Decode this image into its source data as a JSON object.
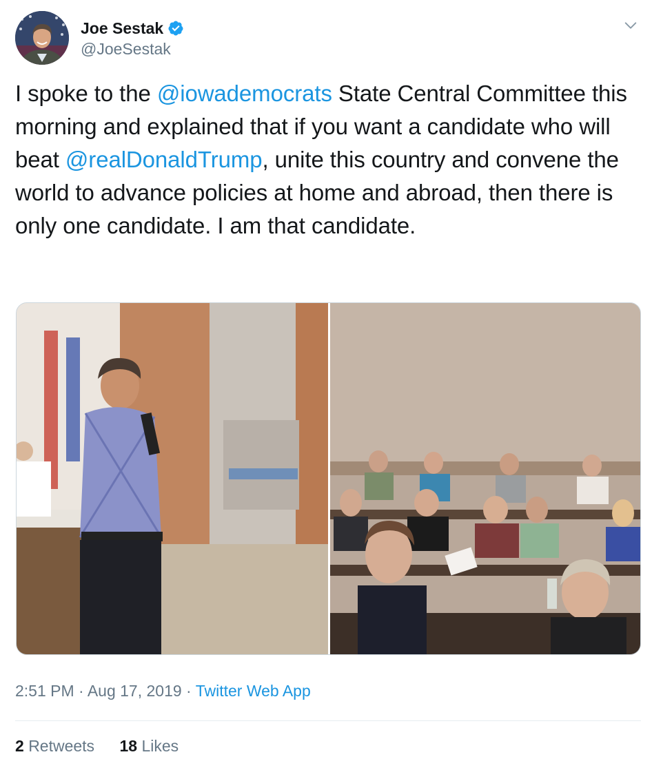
{
  "author": {
    "name": "Joe Sestak",
    "handle": "@JoeSestak",
    "verified": true
  },
  "tweet": {
    "segments": [
      {
        "type": "text",
        "value": "I spoke to the "
      },
      {
        "type": "mention",
        "value": "@iowademocrats"
      },
      {
        "type": "text",
        "value": " State Central Committee this morning and explained that if you want a candidate who will beat "
      },
      {
        "type": "mention",
        "value": "@realDonaldTrump"
      },
      {
        "type": "text",
        "value": ", unite this country and convene the world to advance policies at home and abroad, then there is only one candidate. I am that candidate."
      }
    ]
  },
  "media": [
    {
      "name": "speaker-photo"
    },
    {
      "name": "audience-photo"
    }
  ],
  "meta": {
    "time": "2:51 PM",
    "sep1": " · ",
    "date": "Aug 17, 2019",
    "sep2": " · ",
    "app": "Twitter Web App"
  },
  "stats": {
    "retweets_count": "2",
    "retweets_label": "Retweets",
    "likes_count": "18",
    "likes_label": "Likes"
  },
  "colors": {
    "link": "#1b95e0",
    "secondary": "#657786",
    "verified": "#1da1f2"
  },
  "icons": [
    "verified-badge-icon",
    "chevron-down-icon"
  ]
}
